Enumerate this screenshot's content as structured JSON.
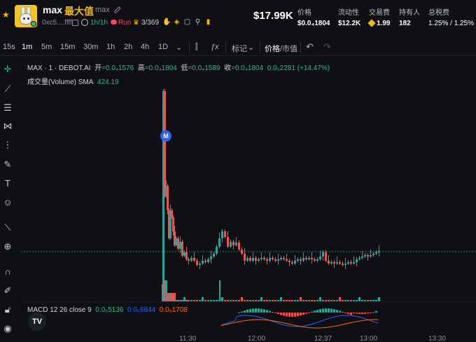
{
  "header": {
    "name": "max",
    "name_cn": "最大值",
    "symbol": "max",
    "address": "0xc5....ffff",
    "age": "1h/1h",
    "run_label": "Run",
    "holders_ratio": "3/369",
    "price": "$17.99K",
    "stats": [
      {
        "label": "价格",
        "value": "$0.0₄1804"
      },
      {
        "label": "流动性",
        "value": "$12.2K"
      },
      {
        "label": "交易费",
        "value": "1.99"
      },
      {
        "label": "持有人",
        "value": "182"
      },
      {
        "label": "总税费",
        "value": "1.25% / 1.25%"
      }
    ]
  },
  "toolbar": {
    "timeframes": [
      "15s",
      "1m",
      "5m",
      "15m",
      "30m",
      "1h",
      "2h",
      "4h",
      "1D"
    ],
    "active_timeframe": "1m",
    "indicators_label": "标记",
    "price_label": "价格",
    "mcap_label": "/市值"
  },
  "legend": {
    "title": "MAX · 1 · DEBOT.AI",
    "open_label": "开",
    "open": "=0.0₄1576",
    "high_label": "高",
    "high": "=0.0₄1804",
    "low_label": "低",
    "low": "=0.0₄1589",
    "close_label": "收",
    "close": "=0.0₄1804",
    "change": "0.0₅2281 (+14.47%)",
    "volume_label": "成交量(Volume) SMA",
    "volume_value": "424.19",
    "macd_label": "MACD 12 26 close 9",
    "macd_v1": "0.0₅5136",
    "macd_v2": "0.0₆6844",
    "macd_v3": "0.0₅1708",
    "marker": "M",
    "tv_logo": "TV"
  },
  "xaxis": [
    "11:30",
    "12:00",
    "12:37",
    "13:00",
    "13:30"
  ],
  "colors": {
    "up": "#26a69a",
    "down": "#ef5350",
    "accent": "#f0b90b",
    "bg": "#0f1014"
  },
  "chart_data": {
    "type": "candlestick",
    "last_close": 1.804e-05,
    "change_pct": 14.47
  }
}
